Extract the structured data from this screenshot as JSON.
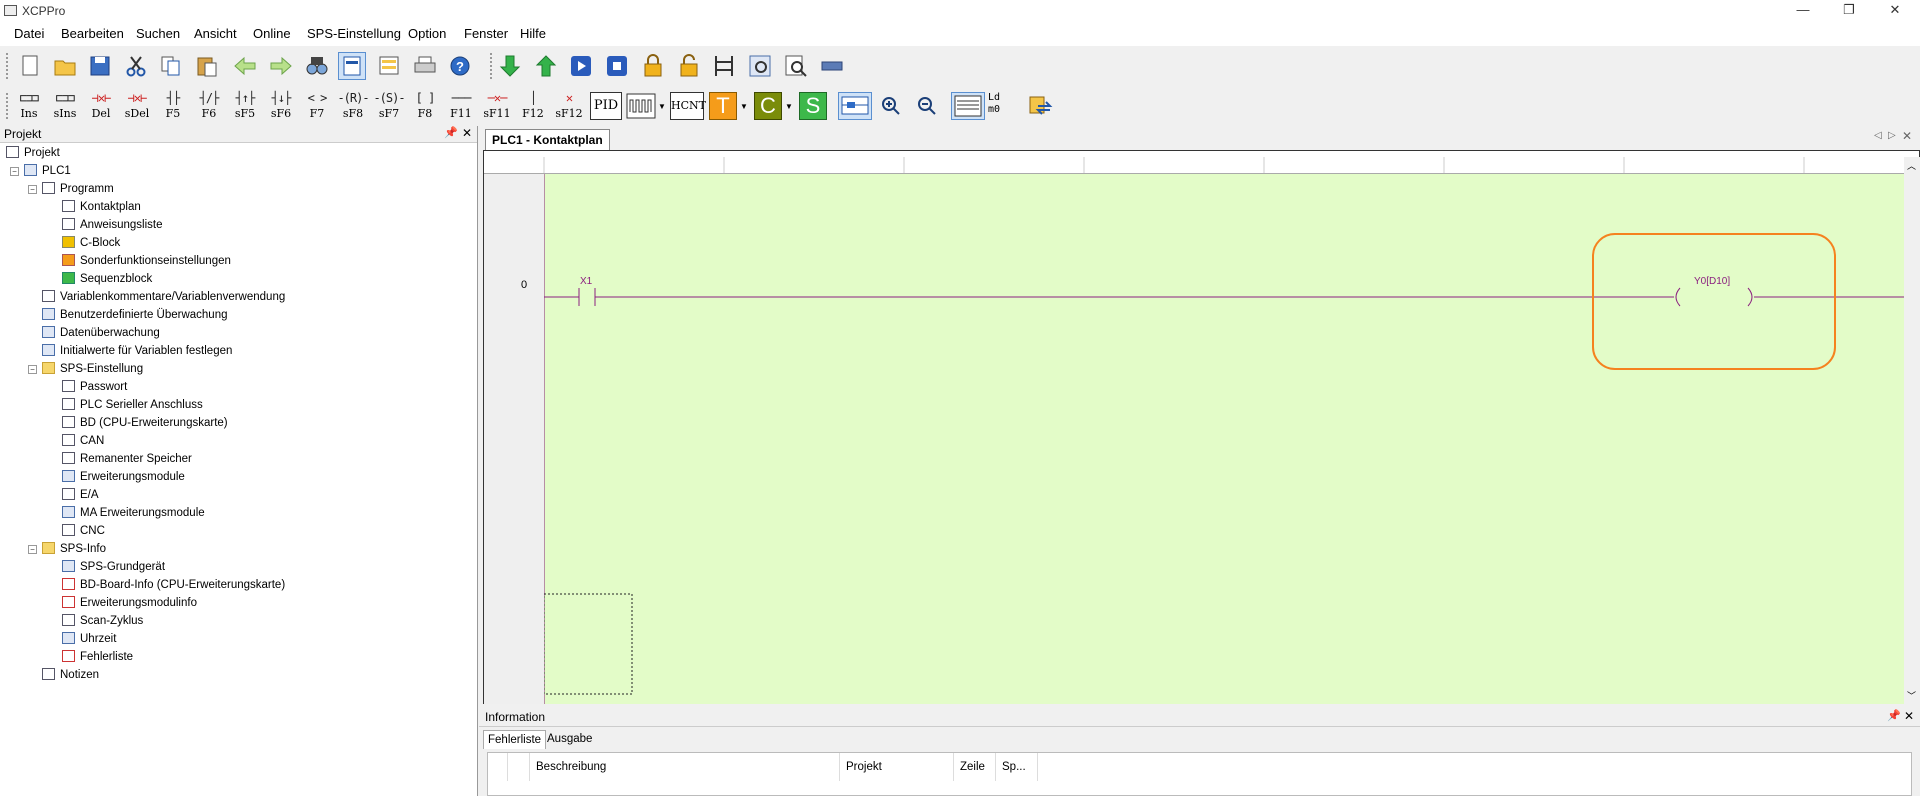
{
  "window": {
    "title": "XCPPro",
    "minimize": "—",
    "restore": "❐",
    "close": "✕"
  },
  "menu": [
    "Datei",
    "Bearbeiten",
    "Suchen",
    "Ansicht",
    "Online",
    "SPS-Einstellung",
    "Option",
    "Fenster",
    "Hilfe"
  ],
  "ladder_toolbar": [
    "Ins",
    "sIns",
    "Del",
    "sDel",
    "F5",
    "F6",
    "sF5",
    "sF6",
    "F7",
    "sF8",
    "sF7",
    "F8",
    "F11",
    "sF11",
    "F12",
    "sF12"
  ],
  "ladder_extra": {
    "pid": "PID",
    "hcnt": "HCNT",
    "t": "T",
    "c": "C",
    "s": "S",
    "ld": "Ld m0"
  },
  "project_panel": {
    "title": "Projekt",
    "tree": [
      {
        "label": "Projekt",
        "level": 0,
        "icon": "doc"
      },
      {
        "label": "PLC1",
        "level": 1,
        "icon": "plc"
      },
      {
        "label": "Programm",
        "level": 2,
        "icon": "doc"
      },
      {
        "label": "Kontaktplan",
        "level": 3,
        "icon": "doc"
      },
      {
        "label": "Anweisungsliste",
        "level": 3,
        "icon": "doc"
      },
      {
        "label": "C-Block",
        "level": 3,
        "icon": "yellow"
      },
      {
        "label": "Sonderfunktionseinstellungen",
        "level": 3,
        "icon": "orange"
      },
      {
        "label": "Sequenzblock",
        "level": 3,
        "icon": "green"
      },
      {
        "label": "Variablenkommentare/Variablenverwendung",
        "level": 2,
        "icon": "doc"
      },
      {
        "label": "Benutzerdefinierte Überwachung",
        "level": 2,
        "icon": "plc"
      },
      {
        "label": "Datenüberwachung",
        "level": 2,
        "icon": "plc"
      },
      {
        "label": "Initialwerte für Variablen festlegen",
        "level": 2,
        "icon": "plc"
      },
      {
        "label": "SPS-Einstellung",
        "level": 2,
        "icon": "folder"
      },
      {
        "label": "Passwort",
        "level": 3,
        "icon": "doc"
      },
      {
        "label": "PLC Serieller Anschluss",
        "level": 3,
        "icon": "doc"
      },
      {
        "label": "BD (CPU-Erweiterungskarte)",
        "level": 3,
        "icon": "doc"
      },
      {
        "label": "CAN",
        "level": 3,
        "icon": "doc"
      },
      {
        "label": "Remanenter Speicher",
        "level": 3,
        "icon": "doc"
      },
      {
        "label": "Erweiterungsmodule",
        "level": 3,
        "icon": "plc"
      },
      {
        "label": "E/A",
        "level": 3,
        "icon": "doc"
      },
      {
        "label": "MA Erweiterungsmodule",
        "level": 3,
        "icon": "plc"
      },
      {
        "label": "CNC",
        "level": 3,
        "icon": "doc"
      },
      {
        "label": "SPS-Info",
        "level": 2,
        "icon": "folder"
      },
      {
        "label": "SPS-Grundgerät",
        "level": 3,
        "icon": "plc"
      },
      {
        "label": "BD-Board-Info (CPU-Erweiterungskarte)",
        "level": 3,
        "icon": "red"
      },
      {
        "label": "Erweiterungsmodulinfo",
        "level": 3,
        "icon": "red"
      },
      {
        "label": "Scan-Zyklus",
        "level": 3,
        "icon": "doc"
      },
      {
        "label": "Uhrzeit",
        "level": 3,
        "icon": "plc"
      },
      {
        "label": "Fehlerliste",
        "level": 3,
        "icon": "red"
      },
      {
        "label": "Notizen",
        "level": 2,
        "icon": "doc"
      }
    ]
  },
  "editor": {
    "tab": "PLC1 - Kontaktplan",
    "rung_number": "0",
    "contact_label": "X1",
    "coil_label": "Y0[D10]",
    "highlight_color": "#f5821f",
    "background_color": "#e3fcc8"
  },
  "info_panel": {
    "title": "Information",
    "tabs": [
      "Fehlerliste",
      "Ausgabe"
    ],
    "columns": [
      "Beschreibung",
      "Projekt",
      "Zeile",
      "Sp..."
    ]
  }
}
